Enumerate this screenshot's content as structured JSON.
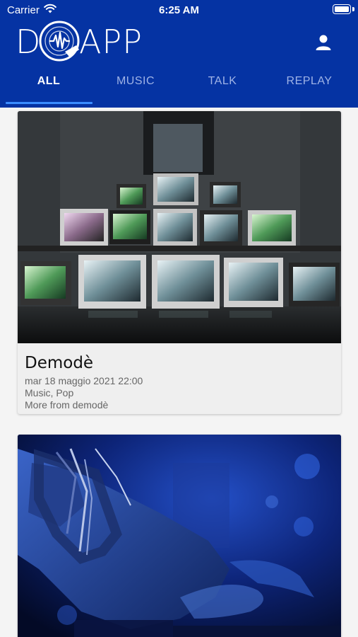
{
  "status_bar": {
    "carrier": "Carrier",
    "time": "6:25 AM"
  },
  "app": {
    "logo_left": "D",
    "logo_right": "APP"
  },
  "tabs": [
    {
      "label": "ALL",
      "active": true
    },
    {
      "label": "MUSIC",
      "active": false
    },
    {
      "label": "TALK",
      "active": false
    },
    {
      "label": "REPLAY",
      "active": false
    }
  ],
  "colors": {
    "header": "#0533a3",
    "tab_indicator": "#3b8dff",
    "background": "#f4f4f4"
  },
  "feed": [
    {
      "title": "Demodè",
      "date": "mar 18 maggio 2021 22:00",
      "genres": "Music, Pop",
      "more": "More from demodè",
      "image": "wall-of-crt-televisions"
    },
    {
      "image": "dj-hands-blue-light"
    }
  ]
}
